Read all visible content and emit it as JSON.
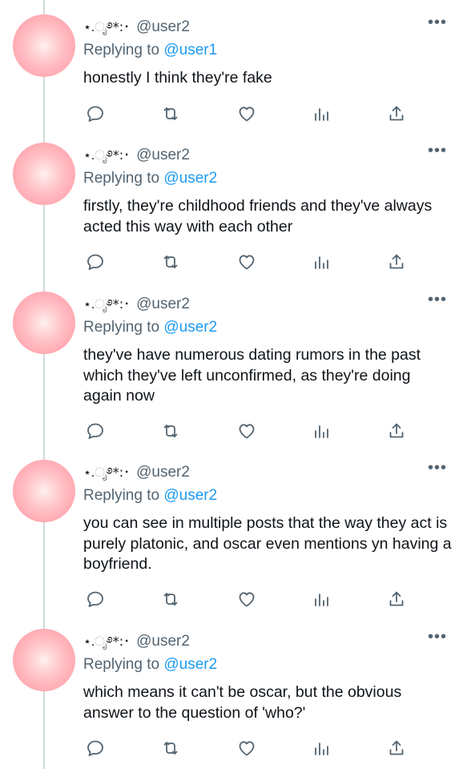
{
  "thread": {
    "tweets": [
      {
        "display_name": "⋆.ೃ࿔*:･",
        "handle": "@user2",
        "reply_prefix": "Replying to",
        "reply_to": "@user1",
        "text": "honestly I think they're fake"
      },
      {
        "display_name": "⋆.ೃ࿔*:･",
        "handle": "@user2",
        "reply_prefix": "Replying to",
        "reply_to": "@user2",
        "text": "firstly, they're childhood friends and they've always acted this way with each other"
      },
      {
        "display_name": "⋆.ೃ࿔*:･",
        "handle": "@user2",
        "reply_prefix": "Replying to",
        "reply_to": "@user2",
        "text": "they've have numerous dating rumors in the past which they've left unconfirmed, as they're doing again now"
      },
      {
        "display_name": "⋆.ೃ࿔*:･",
        "handle": "@user2",
        "reply_prefix": "Replying to",
        "reply_to": "@user2",
        "text": "you can see in multiple posts that the way they act is purely platonic, and oscar even mentions yn having a boyfriend."
      },
      {
        "display_name": "⋆.ೃ࿔*:･",
        "handle": "@user2",
        "reply_prefix": "Replying to",
        "reply_to": "@user2",
        "text": "which means it can't be oscar, but the obvious answer to the question of 'who?'"
      }
    ],
    "more_label": "•••",
    "icons": {
      "reply": "reply-icon",
      "retweet": "retweet-icon",
      "like": "heart-icon",
      "views": "views-icon",
      "share": "share-icon",
      "more": "more-options-icon"
    },
    "colors": {
      "text": "#0f1419",
      "secondary": "#536471",
      "mention": "#1d9bf0",
      "thread_line": "#cfd9de",
      "avatar": "#ffaab2"
    }
  }
}
